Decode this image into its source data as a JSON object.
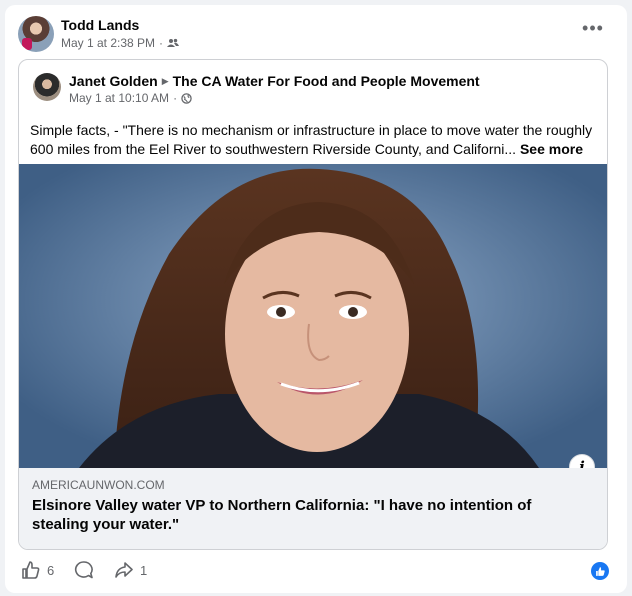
{
  "post": {
    "author": "Todd Lands",
    "timestamp": "May 1 at 2:38 PM",
    "separator": "·",
    "privacy_icon": "friends-icon",
    "more_label": "•••"
  },
  "shared_post": {
    "author": "Janet Golden",
    "group": "The CA Water For Food and People Movement",
    "timestamp": "May 1 at 10:10 AM",
    "separator": "·",
    "privacy_icon": "globe-icon",
    "text": "Simple facts, - \"There is no mechanism or infrastructure in place to move water the roughly 600 miles from the Eel River to southwestern Riverside County, and Californi...",
    "see_more": "See more",
    "link": {
      "domain": "AMERICAUNWON.COM",
      "title": "Elsinore Valley water VP to Northern California: \"I have no intention of stealing your water.\"",
      "info_label": "i"
    }
  },
  "actions": {
    "like_count": "6",
    "comment_count": "",
    "share_count": "1"
  },
  "colors": {
    "accent": "#1877f2",
    "meta_text": "#65676b",
    "link_bg": "#f0f2f5"
  }
}
